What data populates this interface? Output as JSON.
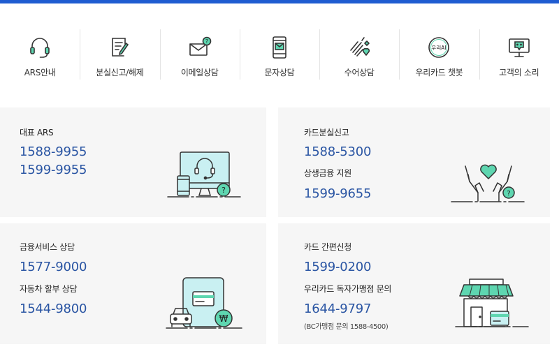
{
  "nav": {
    "items": [
      {
        "label": "ARS안내",
        "icon": "headset-icon"
      },
      {
        "label": "분실신고/해제",
        "icon": "report-pencil-icon"
      },
      {
        "label": "이메일상담",
        "icon": "email-question-icon"
      },
      {
        "label": "문자상담",
        "icon": "phone-message-icon"
      },
      {
        "label": "수어상담",
        "icon": "sign-language-icon"
      },
      {
        "label": "우리카드 챗봇",
        "icon": "chatbot-icon"
      },
      {
        "label": "고객의 소리",
        "icon": "monitor-feedback-icon"
      }
    ],
    "chatbot_badge": "우리AI"
  },
  "cards": {
    "main_ars": {
      "title": "대표 ARS",
      "phone1": "1588-9955",
      "phone2": "1599-9955"
    },
    "lost_card": {
      "title": "카드분실신고",
      "phone": "1588-5300",
      "sub_title": "상생금융 지원",
      "sub_phone": "1599-9655"
    },
    "finance": {
      "title": "금융서비스 상담",
      "phone": "1577-9000",
      "sub_title": "자동차 할부 상담",
      "sub_phone": "1544-9800"
    },
    "simple_card": {
      "title": "카드 간편신청",
      "phone": "1599-0200",
      "sub_title": "우리카드 독자가맹점 문의",
      "sub_phone": "1644-9797",
      "note": "(BC가맹점 문의 1588-4500)"
    }
  },
  "colors": {
    "accent_blue": "#1f5cd1",
    "number_blue": "#2a55a3",
    "mint": "#5ed6b0",
    "card_bg": "#f6f6f6"
  }
}
